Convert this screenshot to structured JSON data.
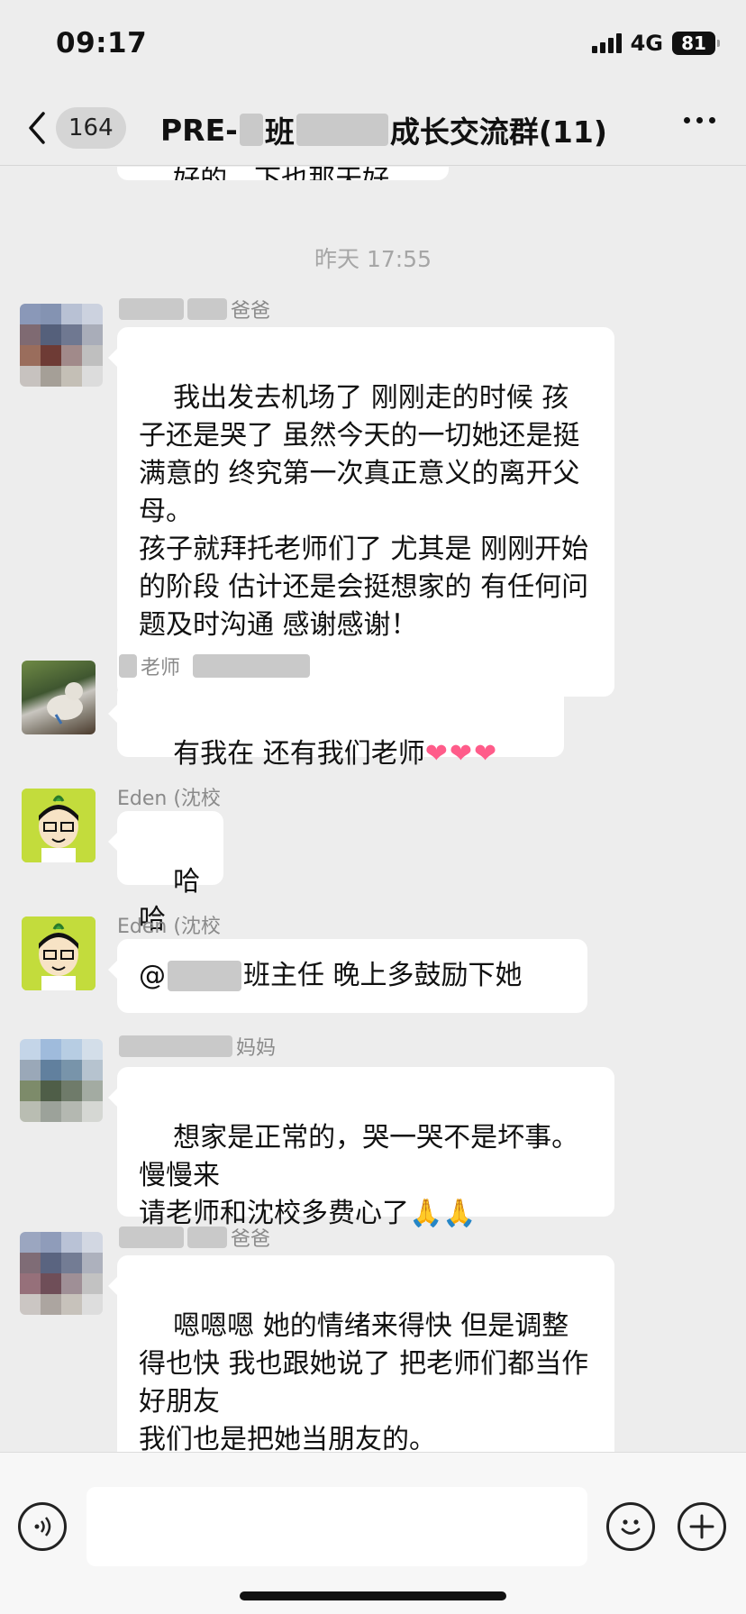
{
  "status": {
    "time": "09:17",
    "network": "4G",
    "battery": "81"
  },
  "nav": {
    "unread_count": "164",
    "title_prefix": "PRE-",
    "title_mid": "班",
    "title_suffix": "成长交流群(11)"
  },
  "timestamp": "昨天 17:55",
  "messages": [
    {
      "sender": "爸爸",
      "text": "我出发去机场了 刚刚走的时候 孩子还是哭了 虽然今天的一切她还是挺满意的 终究第一次真正意义的离开父母。\n孩子就拜托老师们了 尤其是 刚刚开始的阶段 估计还是会挺想家的 有任何问题及时沟通 感谢感谢！"
    },
    {
      "sender": "老师",
      "text": "有我在 还有我们老师",
      "emoji": "❤❤❤"
    },
    {
      "sender": "Eden (沈校",
      "text": "哈哈"
    },
    {
      "sender": "Eden (沈校",
      "text_prefix": "@",
      "text": "班主任 晚上多鼓励下她"
    },
    {
      "sender": "妈妈",
      "text": "想家是正常的，哭一哭不是坏事。\n慢慢来\n请老师和沈校多费心了",
      "emoji": "🙏🙏"
    },
    {
      "sender": "爸爸",
      "text": "嗯嗯嗯 她的情绪来得快 但是调整得也快 我也跟她说了 把老师们都当作好朋友\n我们也是把她当朋友的。"
    }
  ],
  "partial_top_text": "好的，下也那天好"
}
